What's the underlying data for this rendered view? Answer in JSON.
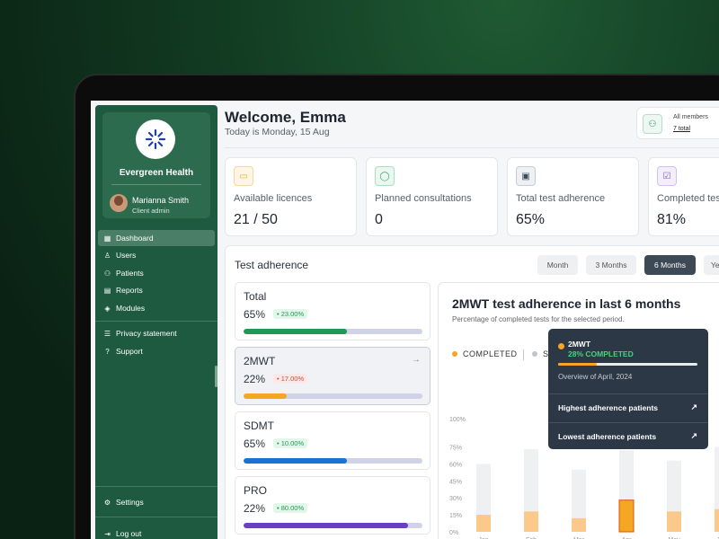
{
  "org": {
    "name": "Evergreen Health"
  },
  "user": {
    "name": "Marianna Smith",
    "role": "Client admin"
  },
  "nav": [
    {
      "label": "Dashboard",
      "icon": "grid-icon"
    },
    {
      "label": "Users",
      "icon": "user-icon"
    },
    {
      "label": "Patients",
      "icon": "users-icon"
    },
    {
      "label": "Reports",
      "icon": "report-icon"
    },
    {
      "label": "Modules",
      "icon": "cube-icon"
    },
    {
      "label": "Privacy statement",
      "icon": "list-icon"
    },
    {
      "label": "Support",
      "icon": "help-icon"
    },
    {
      "label": "Settings",
      "icon": "gear-icon"
    },
    {
      "label": "Log out",
      "icon": "logout-icon"
    }
  ],
  "header": {
    "welcome": "Welcome, Emma",
    "date": "Today is Monday, 15 Aug"
  },
  "members": {
    "label": "All members",
    "count": "7 total"
  },
  "stats": [
    {
      "label": "Available licences",
      "value": "21 / 50",
      "icon": "folder-icon",
      "color": "#f5a623"
    },
    {
      "label": "Planned consultations",
      "value": "0",
      "icon": "chat-icon",
      "color": "#2eaa6a"
    },
    {
      "label": "Total test adherence",
      "value": "65%",
      "icon": "clipboard-icon",
      "color": "#3b4a58"
    },
    {
      "label": "Completed tes",
      "value": "81%",
      "icon": "checklist-icon",
      "color": "#7c5cd6"
    }
  ],
  "adherence": {
    "title": "Test adherence",
    "periods": [
      "Month",
      "3 Months",
      "6 Months",
      "Ye"
    ],
    "active_period": "6 Months",
    "tests": [
      {
        "name": "Total",
        "pct": "65%",
        "change": "• 23.00%",
        "trend": "up",
        "fill": 0.58,
        "color": "#1f9a55"
      },
      {
        "name": "2MWT",
        "pct": "22%",
        "change": "• 17.00%",
        "trend": "down",
        "fill": 0.24,
        "color": "#f5a623"
      },
      {
        "name": "SDMT",
        "pct": "65%",
        "change": "• 10.00%",
        "trend": "up",
        "fill": 0.58,
        "color": "#1a73d4"
      },
      {
        "name": "PRO",
        "pct": "22%",
        "change": "• 80.00%",
        "trend": "up",
        "fill": 0.92,
        "color": "#6a3fc4"
      }
    ]
  },
  "chart": {
    "title": "2MWT test adherence in last 6 months",
    "subtitle": "Percentage of completed tests for the selected period.",
    "legend_completed": "COMPLETED",
    "legend_second": "S"
  },
  "chart_data": {
    "type": "bar",
    "categories": [
      "Jan",
      "Feb",
      "Mar",
      "Apr",
      "May",
      "Jun"
    ],
    "series": [
      {
        "name": "COMPLETED",
        "values": [
          15,
          18,
          12,
          28,
          18,
          20
        ]
      },
      {
        "name": "S",
        "values": [
          60,
          73,
          55,
          72,
          63,
          75
        ]
      }
    ],
    "yticks": [
      "0%",
      "15%",
      "30%",
      "45%",
      "60%",
      "75%",
      "100%"
    ],
    "ylim": [
      0,
      100
    ],
    "highlight": "Apr"
  },
  "tooltip": {
    "name": "2MWT",
    "pct": "28% COMPLETED",
    "overview": "Overview of April, 2024",
    "link1": "Highest adherence patients",
    "link2": "Lowest adherence patients"
  }
}
